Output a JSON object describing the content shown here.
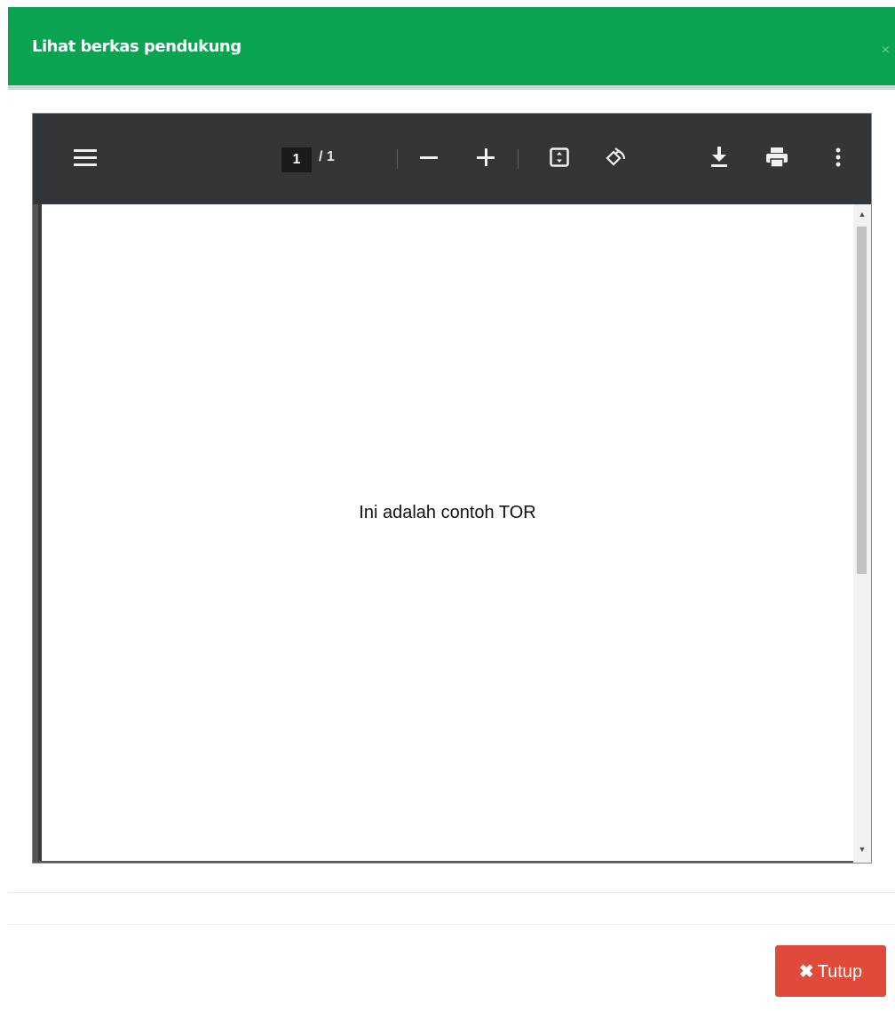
{
  "modal": {
    "title": "Lihat berkas pendukung",
    "close_glyph": "×"
  },
  "pdf_viewer": {
    "current_page": "1",
    "page_separator": "/ 1",
    "toolbar_icons": [
      "menu-icon",
      "zoom-out-icon",
      "zoom-in-icon",
      "fit-page-icon",
      "rotate-icon",
      "download-icon",
      "print-icon",
      "more-options-icon"
    ],
    "document_text": "Ini adalah contoh TOR"
  },
  "footer": {
    "close_button_icon": "✖",
    "close_button_label": "Tutup"
  },
  "colors": {
    "header_green": "#0aa352",
    "toolbar_dark": "#323639",
    "danger_red": "#e04a3b"
  }
}
